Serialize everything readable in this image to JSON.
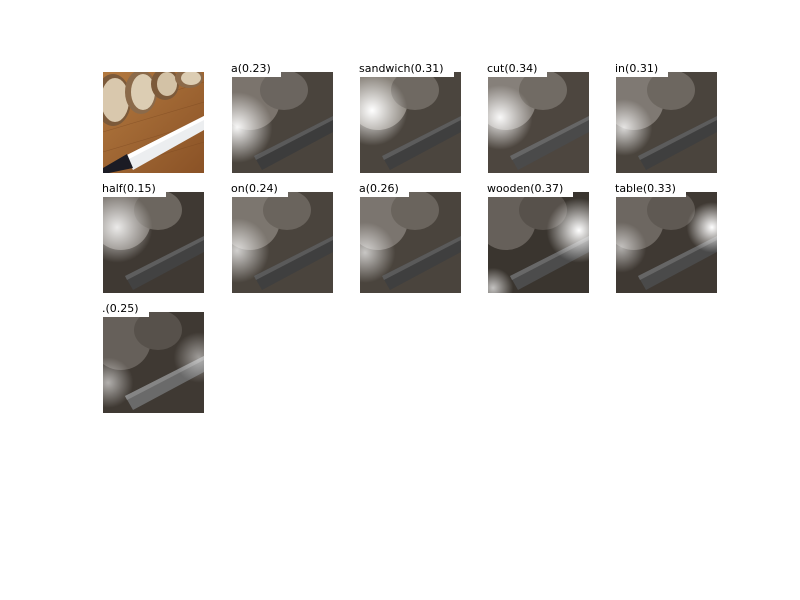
{
  "tiles": [
    {
      "word": "a",
      "score": "(0.23)"
    },
    {
      "word": "sandwich",
      "score": "(0.31)"
    },
    {
      "word": "cut",
      "score": "(0.34)"
    },
    {
      "word": "in",
      "score": "(0.31)"
    },
    {
      "word": "half",
      "score": "(0.15)"
    },
    {
      "word": "on",
      "score": "(0.24)"
    },
    {
      "word": "a",
      "score": "(0.26)"
    },
    {
      "word": "wooden",
      "score": "(0.37)"
    },
    {
      "word": "table",
      "score": "(0.33)"
    },
    {
      "word": ".",
      "score": "(0.25)"
    }
  ],
  "colors": {
    "wood": "#a0642e",
    "bread_crust": "#8b6a4a",
    "bread_crumb": "#d8c9b0",
    "blade": "#e8e8ea",
    "handle": "#1a1a22"
  }
}
